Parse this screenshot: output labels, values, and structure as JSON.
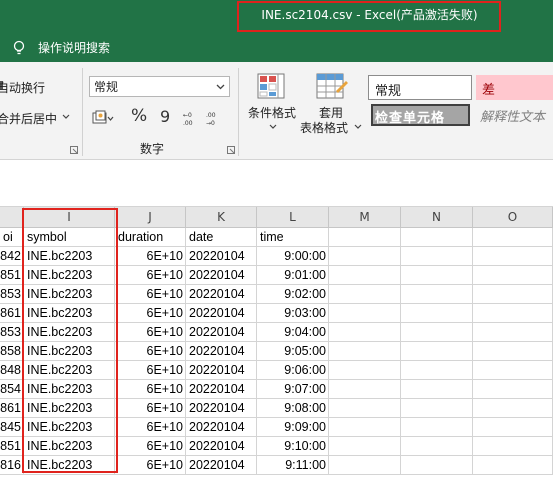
{
  "window": {
    "title": "INE.sc2104.csv  -  Excel(产品激活失败)"
  },
  "tell_me": "操作说明搜索",
  "ribbon": {
    "wrap_text": "自动换行",
    "merge_center": "合并后居中",
    "number_format": "常规",
    "number_group": "数字",
    "percent_symbol": "%",
    "comma_symbol": "9",
    "cond_format": "条件格式",
    "table_format_line1": "套用",
    "table_format_line2": "表格格式",
    "styles": {
      "normal": "常规",
      "bad": "差",
      "check_cell": "检查单元格",
      "explanatory": "解释性文本"
    }
  },
  "sheet": {
    "columns": [
      "I",
      "J",
      "K",
      "L",
      "M",
      "N",
      "O"
    ],
    "headers": [
      "oi",
      "symbol",
      "duration",
      "date",
      "time"
    ],
    "rows": [
      [
        "842",
        "INE.bc2203",
        "6E+10",
        "20220104",
        "9:00:00"
      ],
      [
        "851",
        "INE.bc2203",
        "6E+10",
        "20220104",
        "9:01:00"
      ],
      [
        "853",
        "INE.bc2203",
        "6E+10",
        "20220104",
        "9:02:00"
      ],
      [
        "861",
        "INE.bc2203",
        "6E+10",
        "20220104",
        "9:03:00"
      ],
      [
        "853",
        "INE.bc2203",
        "6E+10",
        "20220104",
        "9:04:00"
      ],
      [
        "858",
        "INE.bc2203",
        "6E+10",
        "20220104",
        "9:05:00"
      ],
      [
        "848",
        "INE.bc2203",
        "6E+10",
        "20220104",
        "9:06:00"
      ],
      [
        "854",
        "INE.bc2203",
        "6E+10",
        "20220104",
        "9:07:00"
      ],
      [
        "861",
        "INE.bc2203",
        "6E+10",
        "20220104",
        "9:08:00"
      ],
      [
        "845",
        "INE.bc2203",
        "6E+10",
        "20220104",
        "9:09:00"
      ],
      [
        "851",
        "INE.bc2203",
        "6E+10",
        "20220104",
        "9:10:00"
      ],
      [
        "816",
        "INE.bc2203",
        "6E+10",
        "20220104",
        "9:11:00"
      ]
    ]
  },
  "colors": {
    "excel_green": "#217346",
    "highlight_red": "#e0231d"
  }
}
